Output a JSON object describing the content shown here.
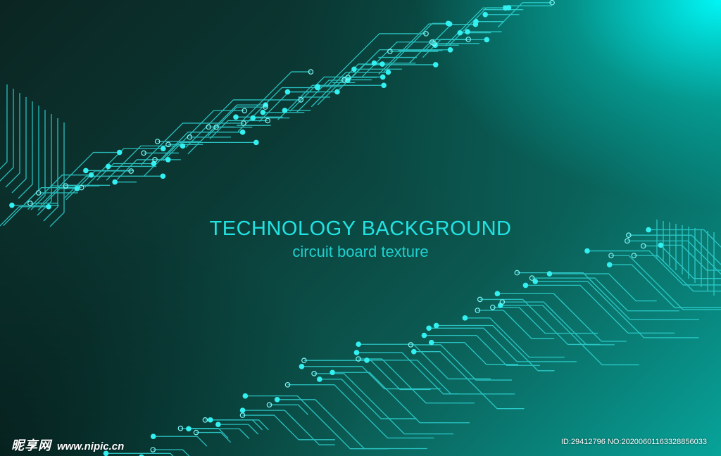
{
  "headline": "TECHNOLOGY BACKGROUND",
  "subline": "circuit board texture",
  "watermark": {
    "logo_text": "昵享网",
    "url": "www.nipic.cn",
    "id_text": "ID:29412796 NO:20200601163328856033"
  },
  "colors": {
    "text_accent": "#22e3e3",
    "trace": "#2fd6d6",
    "pad": "#33f0f0",
    "glow": "#00ffff"
  }
}
